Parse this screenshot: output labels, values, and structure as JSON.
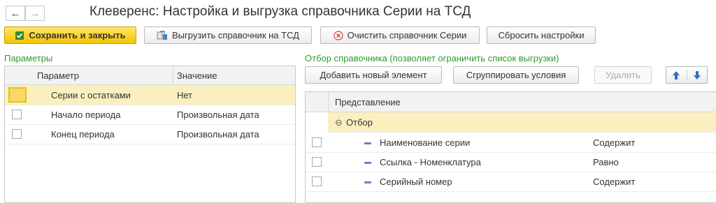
{
  "window": {
    "title": "Клеверенс: Настройка и выгрузка справочника Серии на ТСД",
    "back_glyph": "←",
    "forward_glyph": "→"
  },
  "toolbar": {
    "save_close": "Сохранить и закрыть",
    "export": "Выгрузить справочник на ТСД",
    "clear": "Очистить справочник Серии",
    "reset": "Сбросить настройки"
  },
  "params": {
    "section_label": "Параметры",
    "columns": [
      "Параметр",
      "Значение"
    ],
    "rows": [
      {
        "name": "Серии с остатками",
        "value": "Нет",
        "selected": true
      },
      {
        "name": "Начало периода",
        "value": "Произвольная дата",
        "selected": false
      },
      {
        "name": "Конец периода",
        "value": "Произвольная дата",
        "selected": false
      }
    ]
  },
  "filter": {
    "section_label": "Отбор справочника (позволяет ограничить список выгрузки)",
    "add": "Добавить новый элемент",
    "group": "Сгруппировать условия",
    "delete": "Удалить",
    "column": "Представление",
    "group_row": {
      "toggle": "⊖",
      "label": "Отбор"
    },
    "rows": [
      {
        "name": "Наименование серии",
        "condition": "Содержит"
      },
      {
        "name": "Ссылка - Номенклатура",
        "condition": "Равно"
      },
      {
        "name": "Серийный номер",
        "condition": "Содержит"
      }
    ]
  },
  "colors": {
    "accent_yellow": "#f5c400",
    "section_green": "#2d9b2d",
    "selected_row": "#fbefc0",
    "arrow_blue": "#2f6fc4"
  }
}
